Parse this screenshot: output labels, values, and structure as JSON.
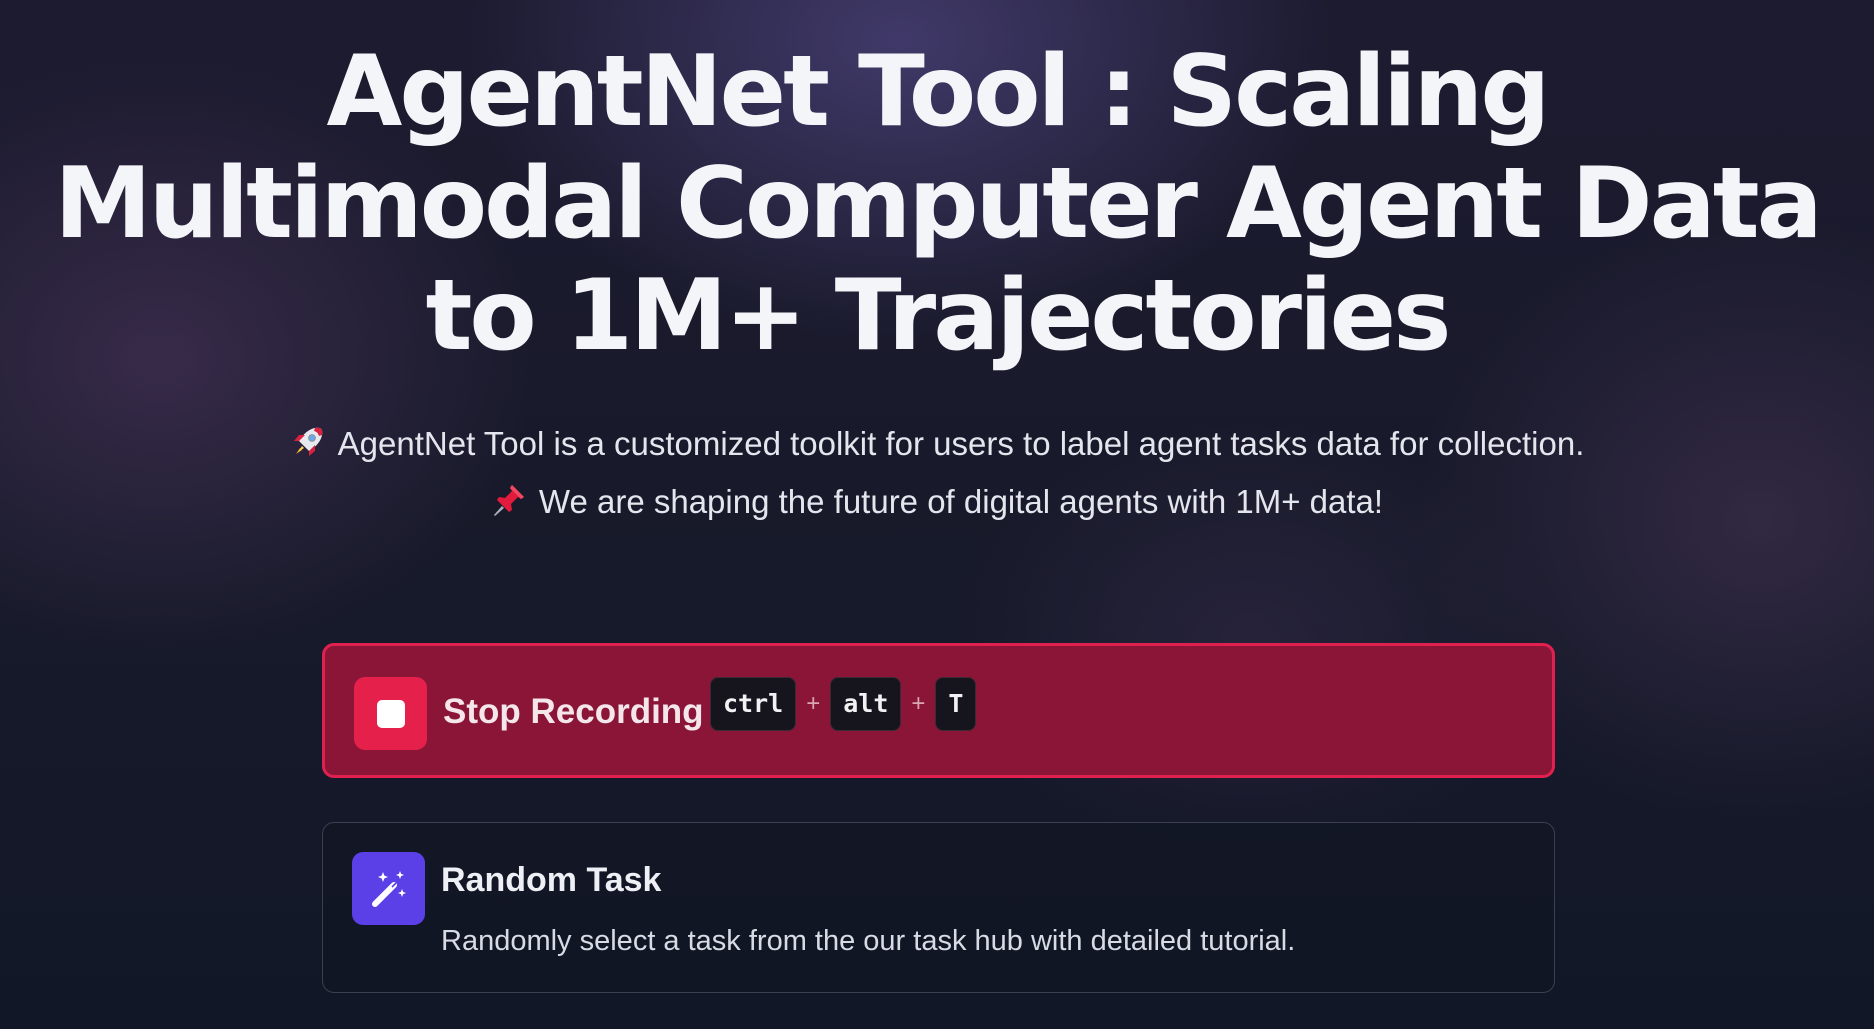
{
  "hero": {
    "title": "AgentNet Tool : Scaling Multimodal Computer Agent Data to 1M+ Trajectories",
    "line1_icon": "rocket-icon",
    "line1": "AgentNet Tool is a customized toolkit for users to label agent tasks data for collection.",
    "line2_icon": "pushpin-icon",
    "line2": "We are shaping the future of digital agents with 1M+ data!"
  },
  "recording": {
    "icon": "stop-icon",
    "label": "Stop Recording",
    "shortcut": {
      "keys": [
        "ctrl",
        "alt",
        "T"
      ],
      "separator": "+"
    }
  },
  "random_task": {
    "icon": "magic-wand-icon",
    "title": "Random Task",
    "description": "Randomly select a task from the our task hub with detailed tutorial."
  },
  "colors": {
    "background": "#141826",
    "recording_card": "#8a1537",
    "recording_border": "#e0214f",
    "stop_button": "#e5214b",
    "task_icon_bg": "#5b40e8"
  }
}
